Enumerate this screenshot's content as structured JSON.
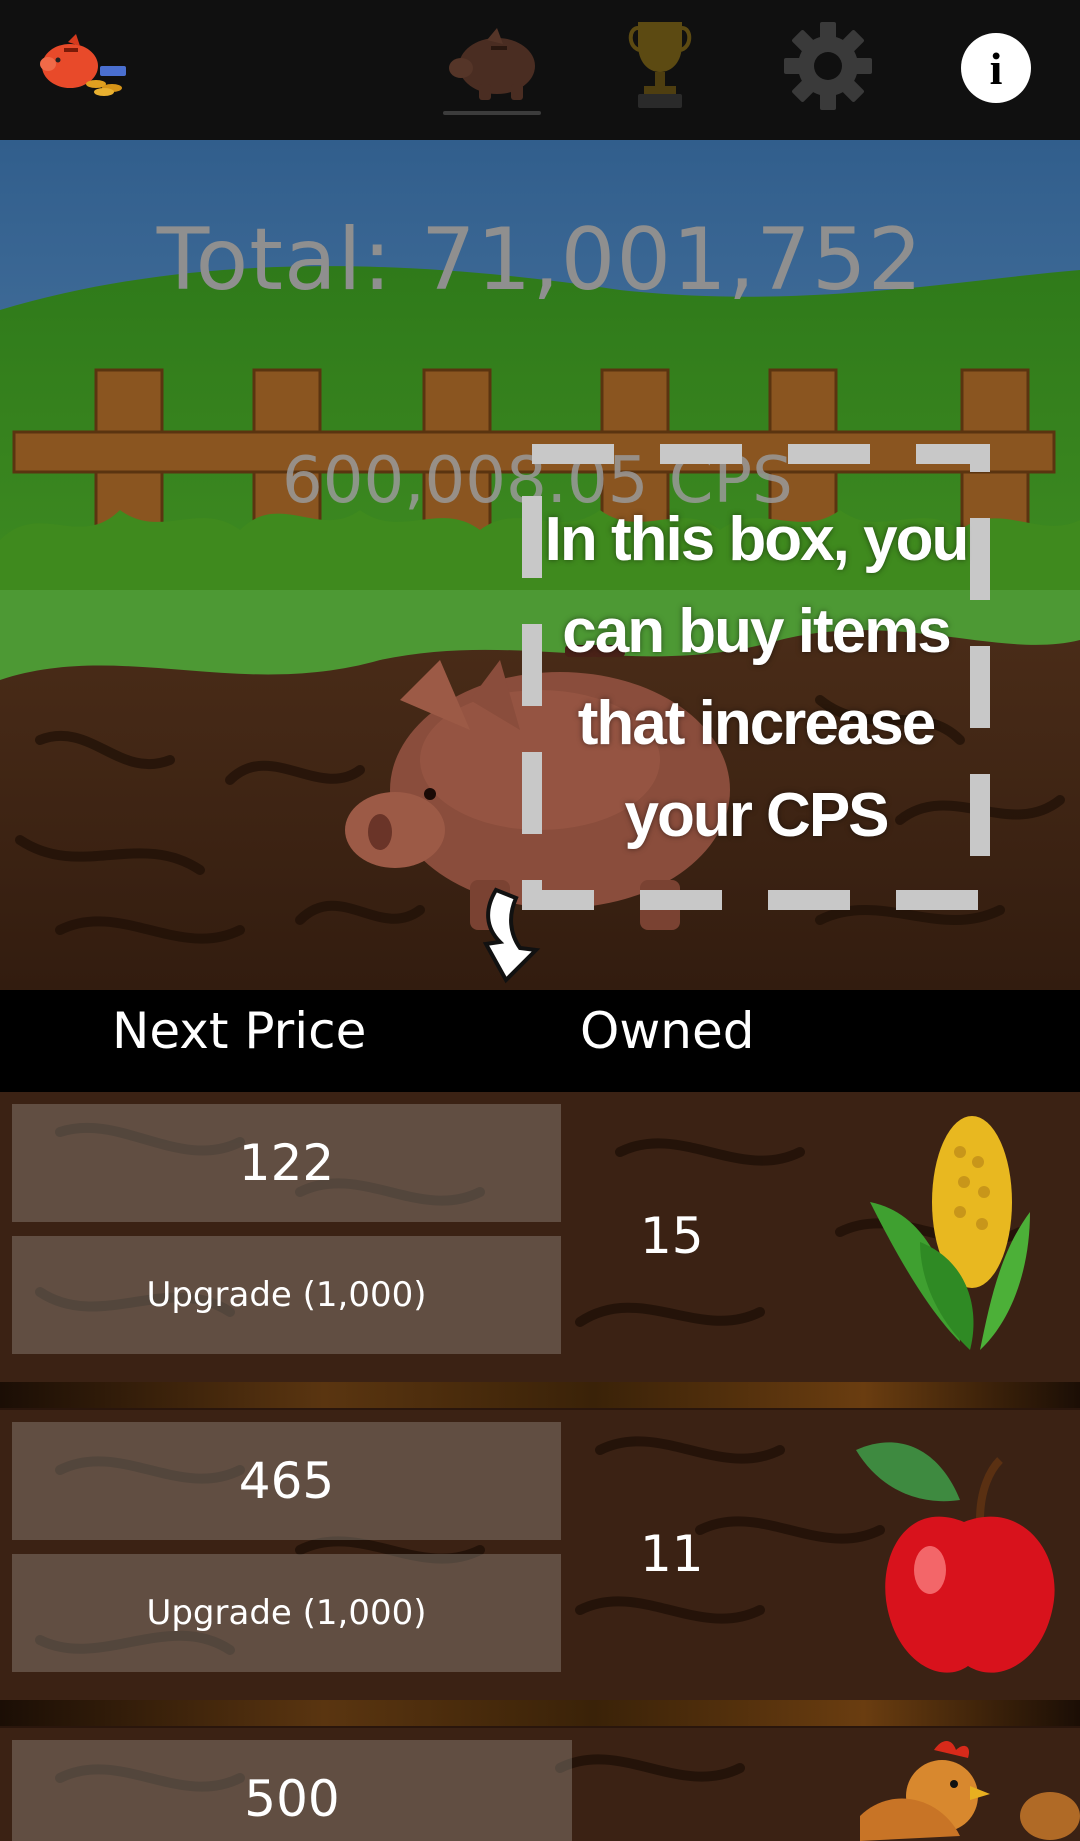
{
  "topbar": {
    "icons": [
      "piggy-bank-logo-icon",
      "piggy-bank-tab-icon",
      "trophy-icon",
      "gear-icon",
      "info-icon"
    ],
    "info_glyph": "i",
    "active_tab": "piggy-bank"
  },
  "stats": {
    "total": "Total: 71,001,752",
    "cps": "600,008.05 CPS"
  },
  "tutorial": {
    "lines": [
      "In this box, you",
      "can buy items",
      "that increase",
      "your CPS"
    ]
  },
  "list_header": {
    "next_price": "Next Price",
    "owned": "Owned"
  },
  "items": [
    {
      "icon": "corn-icon",
      "price": "122",
      "upgrade": "Upgrade (1,000)",
      "owned": "15"
    },
    {
      "icon": "apple-icon",
      "price": "465",
      "upgrade": "Upgrade (1,000)",
      "owned": "11"
    },
    {
      "icon": "chicken-icon",
      "price": "500"
    }
  ],
  "colors": {
    "topbar": "#101010",
    "sky": "#3f6e9c",
    "grass": "#3d8a22",
    "dirt": "#3b2214",
    "button_overlay": "rgba(150,140,132,0.42)"
  }
}
